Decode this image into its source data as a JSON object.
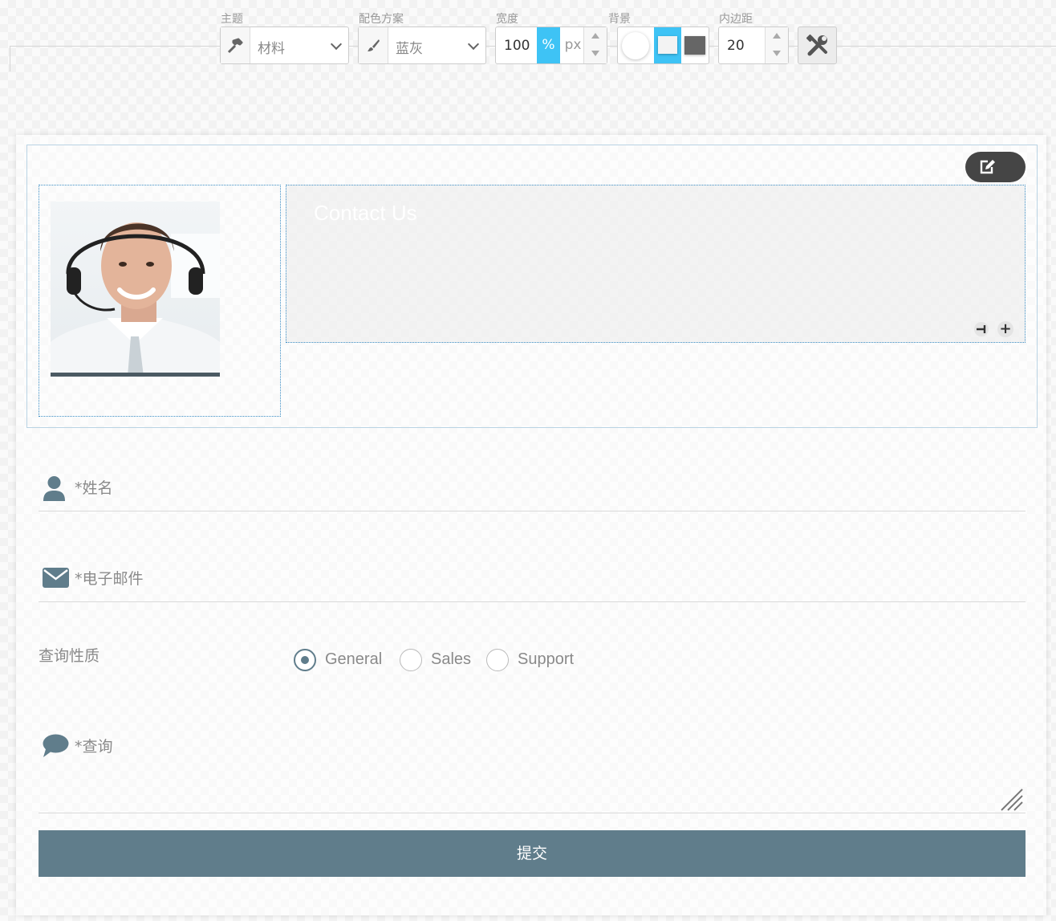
{
  "toolbar": {
    "theme": {
      "label": "主题",
      "value": "材料",
      "icon": "hammer-icon"
    },
    "color_scheme": {
      "label": "配色方案",
      "value": "蓝灰",
      "icon": "brush-icon"
    },
    "width": {
      "label": "宽度",
      "value": "100",
      "unit_percent": "%",
      "unit_px": "px",
      "active_unit": "%"
    },
    "background": {
      "label": "背景",
      "options": [
        "white-circle",
        "light-square",
        "dark-square"
      ],
      "active": "light-square"
    },
    "padding": {
      "label": "内边距",
      "value": "20"
    },
    "settings": {
      "icon": "tools-icon"
    }
  },
  "header": {
    "title": "Contact Us",
    "edit_icon": "edit-icon"
  },
  "form": {
    "name_placeholder": "*姓名",
    "email_placeholder": "*电子邮件",
    "inquiry_type_label": "查询性质",
    "inquiry_options": [
      "General",
      "Sales",
      "Support"
    ],
    "inquiry_selected": "General",
    "message_placeholder": "*查询",
    "submit_label": "提交"
  },
  "colors": {
    "primary": "#607d8b",
    "accent": "#3ec3f5",
    "edit_button": "#454545",
    "border_blue": "#3d8fc6"
  }
}
